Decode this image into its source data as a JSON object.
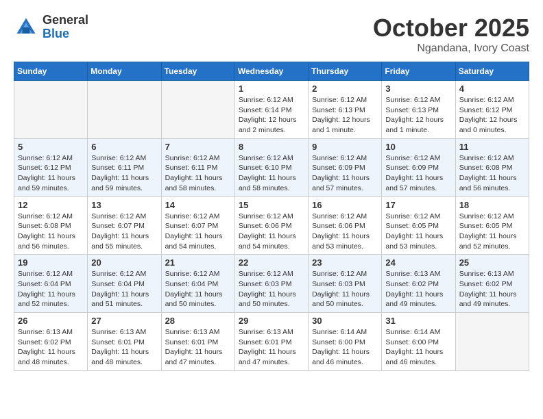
{
  "header": {
    "logo_general": "General",
    "logo_blue": "Blue",
    "month": "October 2025",
    "location": "Ngandana, Ivory Coast"
  },
  "weekdays": [
    "Sunday",
    "Monday",
    "Tuesday",
    "Wednesday",
    "Thursday",
    "Friday",
    "Saturday"
  ],
  "weeks": [
    [
      {
        "day": "",
        "info": ""
      },
      {
        "day": "",
        "info": ""
      },
      {
        "day": "",
        "info": ""
      },
      {
        "day": "1",
        "info": "Sunrise: 6:12 AM\nSunset: 6:14 PM\nDaylight: 12 hours\nand 2 minutes."
      },
      {
        "day": "2",
        "info": "Sunrise: 6:12 AM\nSunset: 6:13 PM\nDaylight: 12 hours\nand 1 minute."
      },
      {
        "day": "3",
        "info": "Sunrise: 6:12 AM\nSunset: 6:13 PM\nDaylight: 12 hours\nand 1 minute."
      },
      {
        "day": "4",
        "info": "Sunrise: 6:12 AM\nSunset: 6:12 PM\nDaylight: 12 hours\nand 0 minutes."
      }
    ],
    [
      {
        "day": "5",
        "info": "Sunrise: 6:12 AM\nSunset: 6:12 PM\nDaylight: 11 hours\nand 59 minutes."
      },
      {
        "day": "6",
        "info": "Sunrise: 6:12 AM\nSunset: 6:11 PM\nDaylight: 11 hours\nand 59 minutes."
      },
      {
        "day": "7",
        "info": "Sunrise: 6:12 AM\nSunset: 6:11 PM\nDaylight: 11 hours\nand 58 minutes."
      },
      {
        "day": "8",
        "info": "Sunrise: 6:12 AM\nSunset: 6:10 PM\nDaylight: 11 hours\nand 58 minutes."
      },
      {
        "day": "9",
        "info": "Sunrise: 6:12 AM\nSunset: 6:09 PM\nDaylight: 11 hours\nand 57 minutes."
      },
      {
        "day": "10",
        "info": "Sunrise: 6:12 AM\nSunset: 6:09 PM\nDaylight: 11 hours\nand 57 minutes."
      },
      {
        "day": "11",
        "info": "Sunrise: 6:12 AM\nSunset: 6:08 PM\nDaylight: 11 hours\nand 56 minutes."
      }
    ],
    [
      {
        "day": "12",
        "info": "Sunrise: 6:12 AM\nSunset: 6:08 PM\nDaylight: 11 hours\nand 56 minutes."
      },
      {
        "day": "13",
        "info": "Sunrise: 6:12 AM\nSunset: 6:07 PM\nDaylight: 11 hours\nand 55 minutes."
      },
      {
        "day": "14",
        "info": "Sunrise: 6:12 AM\nSunset: 6:07 PM\nDaylight: 11 hours\nand 54 minutes."
      },
      {
        "day": "15",
        "info": "Sunrise: 6:12 AM\nSunset: 6:06 PM\nDaylight: 11 hours\nand 54 minutes."
      },
      {
        "day": "16",
        "info": "Sunrise: 6:12 AM\nSunset: 6:06 PM\nDaylight: 11 hours\nand 53 minutes."
      },
      {
        "day": "17",
        "info": "Sunrise: 6:12 AM\nSunset: 6:05 PM\nDaylight: 11 hours\nand 53 minutes."
      },
      {
        "day": "18",
        "info": "Sunrise: 6:12 AM\nSunset: 6:05 PM\nDaylight: 11 hours\nand 52 minutes."
      }
    ],
    [
      {
        "day": "19",
        "info": "Sunrise: 6:12 AM\nSunset: 6:04 PM\nDaylight: 11 hours\nand 52 minutes."
      },
      {
        "day": "20",
        "info": "Sunrise: 6:12 AM\nSunset: 6:04 PM\nDaylight: 11 hours\nand 51 minutes."
      },
      {
        "day": "21",
        "info": "Sunrise: 6:12 AM\nSunset: 6:04 PM\nDaylight: 11 hours\nand 50 minutes."
      },
      {
        "day": "22",
        "info": "Sunrise: 6:12 AM\nSunset: 6:03 PM\nDaylight: 11 hours\nand 50 minutes."
      },
      {
        "day": "23",
        "info": "Sunrise: 6:12 AM\nSunset: 6:03 PM\nDaylight: 11 hours\nand 50 minutes."
      },
      {
        "day": "24",
        "info": "Sunrise: 6:13 AM\nSunset: 6:02 PM\nDaylight: 11 hours\nand 49 minutes."
      },
      {
        "day": "25",
        "info": "Sunrise: 6:13 AM\nSunset: 6:02 PM\nDaylight: 11 hours\nand 49 minutes."
      }
    ],
    [
      {
        "day": "26",
        "info": "Sunrise: 6:13 AM\nSunset: 6:02 PM\nDaylight: 11 hours\nand 48 minutes."
      },
      {
        "day": "27",
        "info": "Sunrise: 6:13 AM\nSunset: 6:01 PM\nDaylight: 11 hours\nand 48 minutes."
      },
      {
        "day": "28",
        "info": "Sunrise: 6:13 AM\nSunset: 6:01 PM\nDaylight: 11 hours\nand 47 minutes."
      },
      {
        "day": "29",
        "info": "Sunrise: 6:13 AM\nSunset: 6:01 PM\nDaylight: 11 hours\nand 47 minutes."
      },
      {
        "day": "30",
        "info": "Sunrise: 6:14 AM\nSunset: 6:00 PM\nDaylight: 11 hours\nand 46 minutes."
      },
      {
        "day": "31",
        "info": "Sunrise: 6:14 AM\nSunset: 6:00 PM\nDaylight: 11 hours\nand 46 minutes."
      },
      {
        "day": "",
        "info": ""
      }
    ]
  ]
}
